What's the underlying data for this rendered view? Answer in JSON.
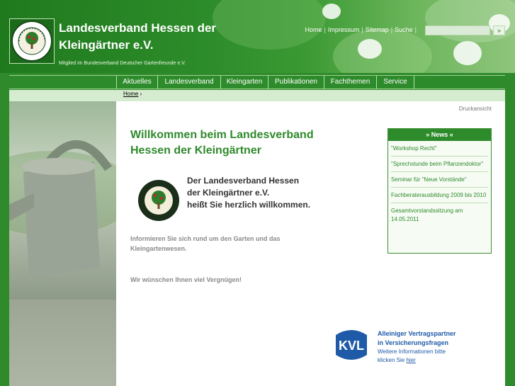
{
  "header": {
    "title_line1": "Landesverband Hessen der",
    "title_line2": "Kleingärtner e.V.",
    "subtitle": "Mitglied im Bundesverband Deutscher Gartenfreunde e.V.",
    "logo_text_top": "LANDESVERBAND HESSEN",
    "logo_text_bottom": "DER KLEINGÄRTNER E.V."
  },
  "topnav": {
    "home": "Home",
    "impressum": "Impressum",
    "sitemap": "Sitemap",
    "suche": "Suche",
    "search_placeholder": "",
    "search_go": "»"
  },
  "nav": {
    "items": [
      "Aktuelles",
      "Landesverband",
      "Kleingarten",
      "Publikationen",
      "Fachthemen",
      "Service"
    ]
  },
  "breadcrumb": {
    "home": "Home",
    "sep": "›"
  },
  "main": {
    "print_view": "Druckansicht",
    "welcome": "Willkommen beim Landesverband Hessen der Kleingärtner",
    "greeting_line1": "Der Landesverband Hessen",
    "greeting_line2": "der Kleingärtner e.V.",
    "greeting_line3": "heißt Sie herzlich willkommen.",
    "info": "Informieren Sie sich rund um den Garten und das Kleingartenwesen.",
    "enjoy": "Wir wünschen Ihnen viel Vergnügen!"
  },
  "news": {
    "heading": "» News «",
    "items": [
      "\"Workshop Recht\"",
      "\"Sprechstunde beim Pflanzendoktor\"",
      "Seminar für \"Neue Vorstände\"",
      "Fachberaterausbildung 2009 bis 2010",
      "Gesamtvorstandssitzung am 14.05.2011"
    ]
  },
  "kvl": {
    "logo_text": "KVL",
    "title_line1": "Alleiniger Vertragspartner",
    "title_line2": "in Versicherungsfragen",
    "more_line1": "Weitere Informationen bitte",
    "more_prefix": "klicken Sie",
    "more_link": "hier"
  },
  "colors": {
    "brand_green": "#2e8b2b",
    "light_green": "#d6ecd0",
    "kvl_blue": "#1e5aa8"
  }
}
